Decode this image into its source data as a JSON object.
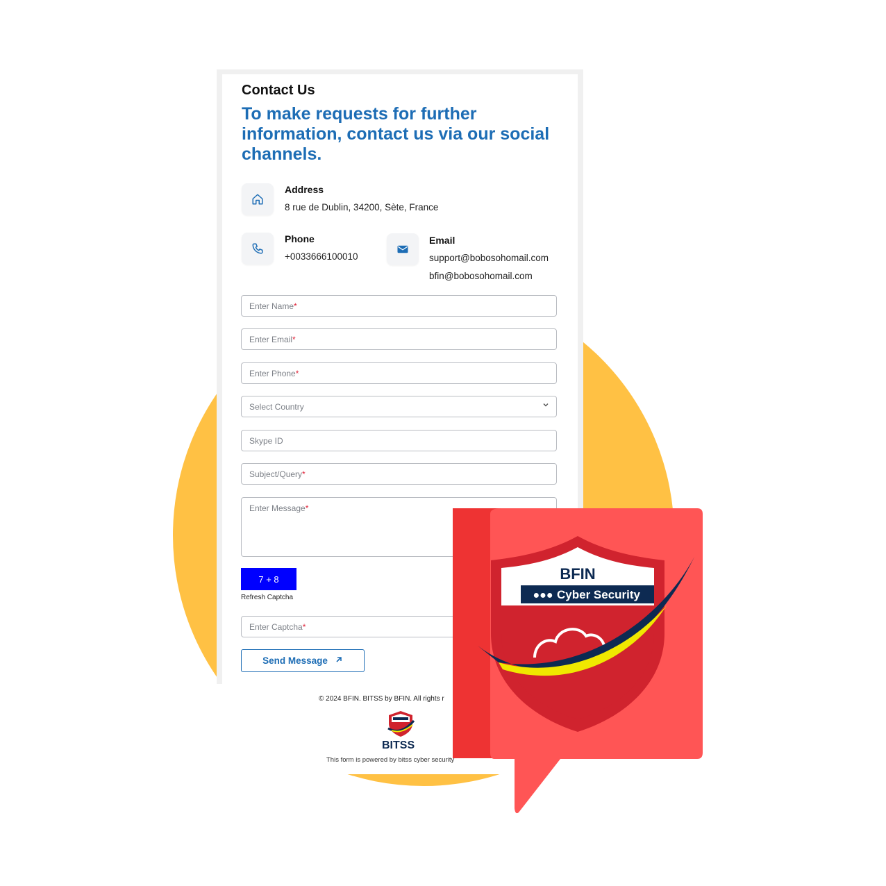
{
  "contact": {
    "title": "Contact Us",
    "headline": "To make requests for further information, contact us via our social channels.",
    "address_label": "Address",
    "address_value": "8 rue de Dublin, 34200, Sète, France",
    "phone_label": "Phone",
    "phone_value": "+0033666100010",
    "email_label": "Email",
    "email_values": [
      "support@bobosohomail.com",
      "bfin@bobosohomail.com"
    ]
  },
  "form": {
    "name_placeholder": "Enter Name",
    "email_placeholder": "Enter Email",
    "phone_placeholder": "Enter Phone",
    "country_placeholder": "Select Country",
    "skype_placeholder": "Skype ID",
    "subject_placeholder": "Subject/Query",
    "message_placeholder": "Enter Message",
    "required_mark": "*",
    "captcha_text": "7 + 8",
    "refresh_label": "Refresh Captcha",
    "captcha_placeholder": "Enter Captcha",
    "send_label": "Send Message"
  },
  "footer": {
    "copyright": "© 2024 BFIN. BITSS by BFIN. All rights r",
    "brand": "BITSS",
    "powered": "This form is powered by bitss cyber security"
  },
  "badge": {
    "brand": "BFIN",
    "tagline": "Cyber Security",
    "dots": "●●●"
  },
  "colors": {
    "accent": "#1d6db5",
    "captcha_bg": "#0000ff",
    "circle": "#ffc144",
    "badge_red": "#ff5555",
    "shield_red": "#d0232e",
    "navy": "#0d2a52"
  }
}
